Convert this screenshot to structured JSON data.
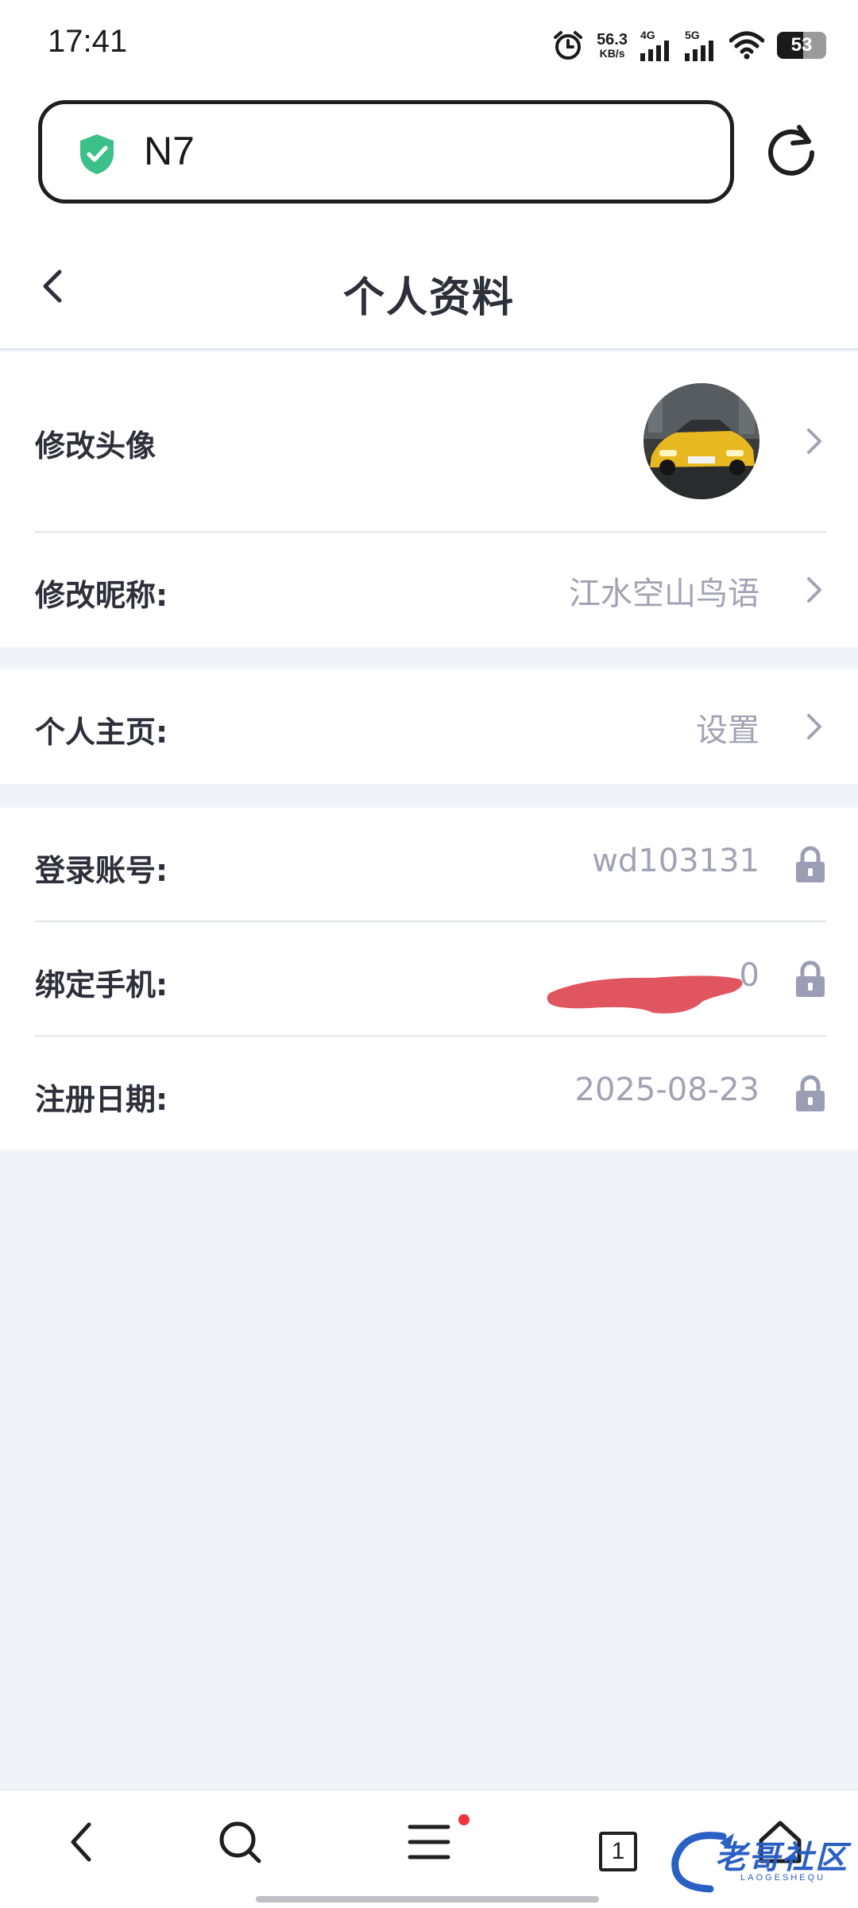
{
  "status_bar": {
    "time": "17:41",
    "net_speed_value": "56.3",
    "net_speed_unit": "KB/s",
    "signal_1_label": "4G",
    "signal_2_label": "5G",
    "battery_level": "53",
    "icons": [
      "alarm-icon",
      "signal-icon",
      "signal-icon",
      "wifi-icon",
      "battery-icon"
    ]
  },
  "browser": {
    "url_text": "N7",
    "security_icon": "shield-check-icon",
    "reload_icon": "reload-icon",
    "accent_color": "#3cc08a"
  },
  "header": {
    "title": "个人资料",
    "back_icon": "chevron-left-icon"
  },
  "profile": {
    "avatar_label": "修改头像",
    "nickname_label": "修改昵称:",
    "nickname_value": "江水空山鸟语",
    "homepage_label": "个人主页:",
    "homepage_value": "设置",
    "account_label": "登录账号:",
    "account_value": "wd103131",
    "phone_label": "绑定手机:",
    "phone_value_visible": "0",
    "phone_redacted": true,
    "register_label": "注册日期:",
    "register_value": "2025-08-23",
    "value_color": "#a0a3b4",
    "lock_color": "#9a9db4"
  },
  "bottom_nav": {
    "tab_count": "1",
    "menu_has_badge": true,
    "icons": [
      "back-icon",
      "search-icon",
      "menu-icon",
      "tabs-icon",
      "home-icon"
    ]
  },
  "watermark": {
    "text": "老哥社区",
    "subtext": "LAOGESHEQU"
  }
}
